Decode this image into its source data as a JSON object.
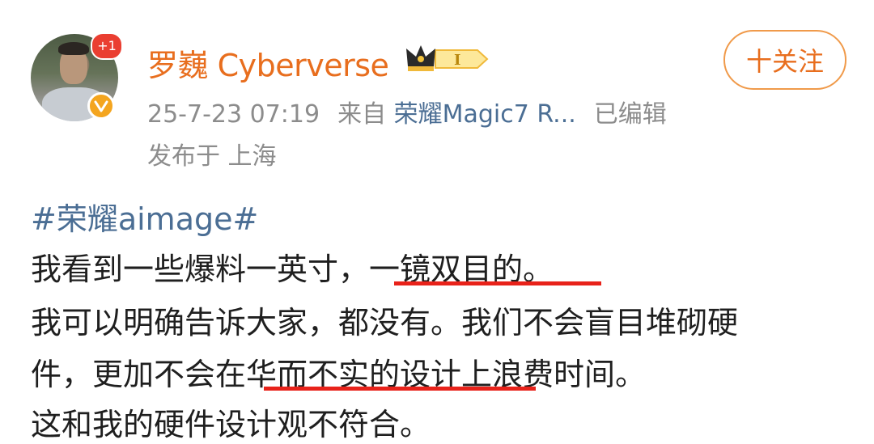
{
  "user": {
    "name": "罗巍 Cyberverse",
    "notification_badge": "+1"
  },
  "follow_button_label": "十关注",
  "meta": {
    "timestamp": "25-7-23 07:19",
    "source_prefix": "来自",
    "device": "荣耀Magic7 R...",
    "edited": "已编辑",
    "location": "发布于 上海"
  },
  "post": {
    "topic": "#荣耀aimage#",
    "lines": [
      "我看到一些爆料一英寸，一镜双目的。",
      "我可以明确告诉大家，都没有。我们不会盲目堆砌硬",
      "件，更加不会在华而不实的设计上浪费时间。",
      "这和我的硬件设计观不符合。"
    ]
  },
  "colors": {
    "username": "#e86e1e",
    "link": "#4b6e94",
    "meta_text": "#8c8c8c",
    "underline": "#e8221a",
    "badge_red": "#ea3e31",
    "verified_gold": "#f4a51f"
  },
  "icons": [
    "avatar",
    "verified-v-icon",
    "crown-member-icon"
  ]
}
